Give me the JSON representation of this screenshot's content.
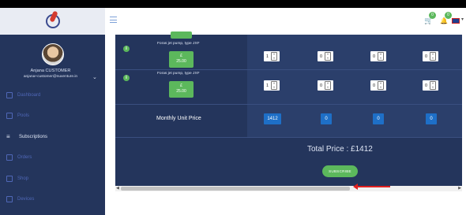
{
  "sidebar": {
    "user_name": "Anjana CUSTOMER",
    "user_email": "anjana+customer@nuventure.in",
    "items": [
      {
        "label": "Dashboard",
        "icon": "grid-icon"
      },
      {
        "label": "Pools",
        "icon": "pool-icon"
      },
      {
        "label": "Subscriptions",
        "icon": "subscriptions-icon"
      },
      {
        "label": "Orders",
        "icon": "orders-icon"
      },
      {
        "label": "Shop",
        "icon": "shop-icon"
      },
      {
        "label": "Devices",
        "icon": "devices-icon"
      }
    ]
  },
  "header": {
    "cart_count": "0",
    "notification_count": "0"
  },
  "table": {
    "products": [
      {
        "name": "Foras jet pump, type JXF",
        "currency": "£",
        "price": "25.00",
        "qty": [
          "1",
          "0",
          "0",
          "0"
        ]
      },
      {
        "name": "Foras jet pump, type JXF",
        "currency": "£",
        "price": "25.00",
        "qty": [
          "1",
          "0",
          "0",
          "0"
        ]
      }
    ],
    "monthly_label": "Monthly Unit Price",
    "monthly_values": [
      "1412",
      "0",
      "0",
      "0"
    ]
  },
  "total_price": "Total Price : £1412",
  "subscribe_label": "SUBSCRIBE",
  "colors": {
    "sidebar_bg": "#24355c",
    "accent_green": "#5cb85c",
    "accent_blue": "#1e6fc7",
    "arrow_red": "#e02020"
  }
}
